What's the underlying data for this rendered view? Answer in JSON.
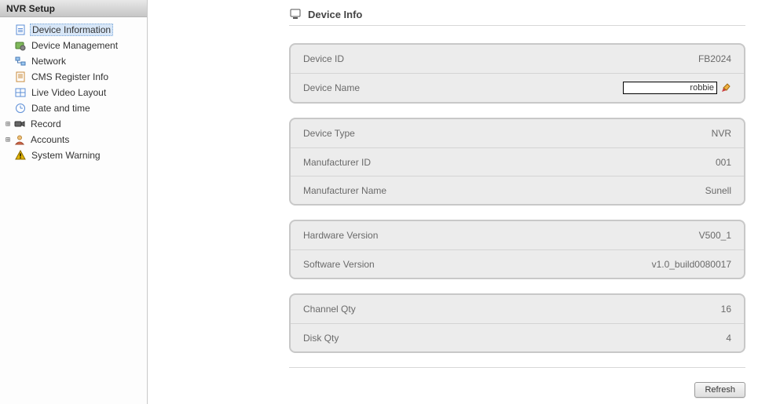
{
  "sidebar": {
    "title": "NVR Setup",
    "items": [
      {
        "label": "Device Information",
        "icon": "doc-info-icon",
        "selected": true
      },
      {
        "label": "Device Management",
        "icon": "gear-screen-icon"
      },
      {
        "label": "Network",
        "icon": "network-icon"
      },
      {
        "label": "CMS Register Info",
        "icon": "doc-register-icon"
      },
      {
        "label": "Live Video Layout",
        "icon": "layout-icon"
      },
      {
        "label": "Date and time",
        "icon": "clock-icon"
      },
      {
        "label": "Record",
        "icon": "camera-icon",
        "expandable": true
      },
      {
        "label": "Accounts",
        "icon": "user-icon",
        "expandable": true
      },
      {
        "label": "System Warning",
        "icon": "warning-icon"
      }
    ]
  },
  "page": {
    "title": "Device Info",
    "groups": [
      {
        "rows": [
          {
            "label": "Device ID",
            "value": "FB2024"
          },
          {
            "label": "Device Name",
            "editable": true,
            "value": "robbie"
          }
        ]
      },
      {
        "rows": [
          {
            "label": "Device Type",
            "value": "NVR"
          },
          {
            "label": "Manufacturer ID",
            "value": "001"
          },
          {
            "label": "Manufacturer Name",
            "value": "Sunell"
          }
        ]
      },
      {
        "rows": [
          {
            "label": "Hardware Version",
            "value": "V500_1"
          },
          {
            "label": "Software Version",
            "value": "v1.0_build0080017"
          }
        ]
      },
      {
        "rows": [
          {
            "label": "Channel Qty",
            "value": "16"
          },
          {
            "label": "Disk Qty",
            "value": "4"
          }
        ]
      }
    ],
    "refresh_label": "Refresh"
  }
}
